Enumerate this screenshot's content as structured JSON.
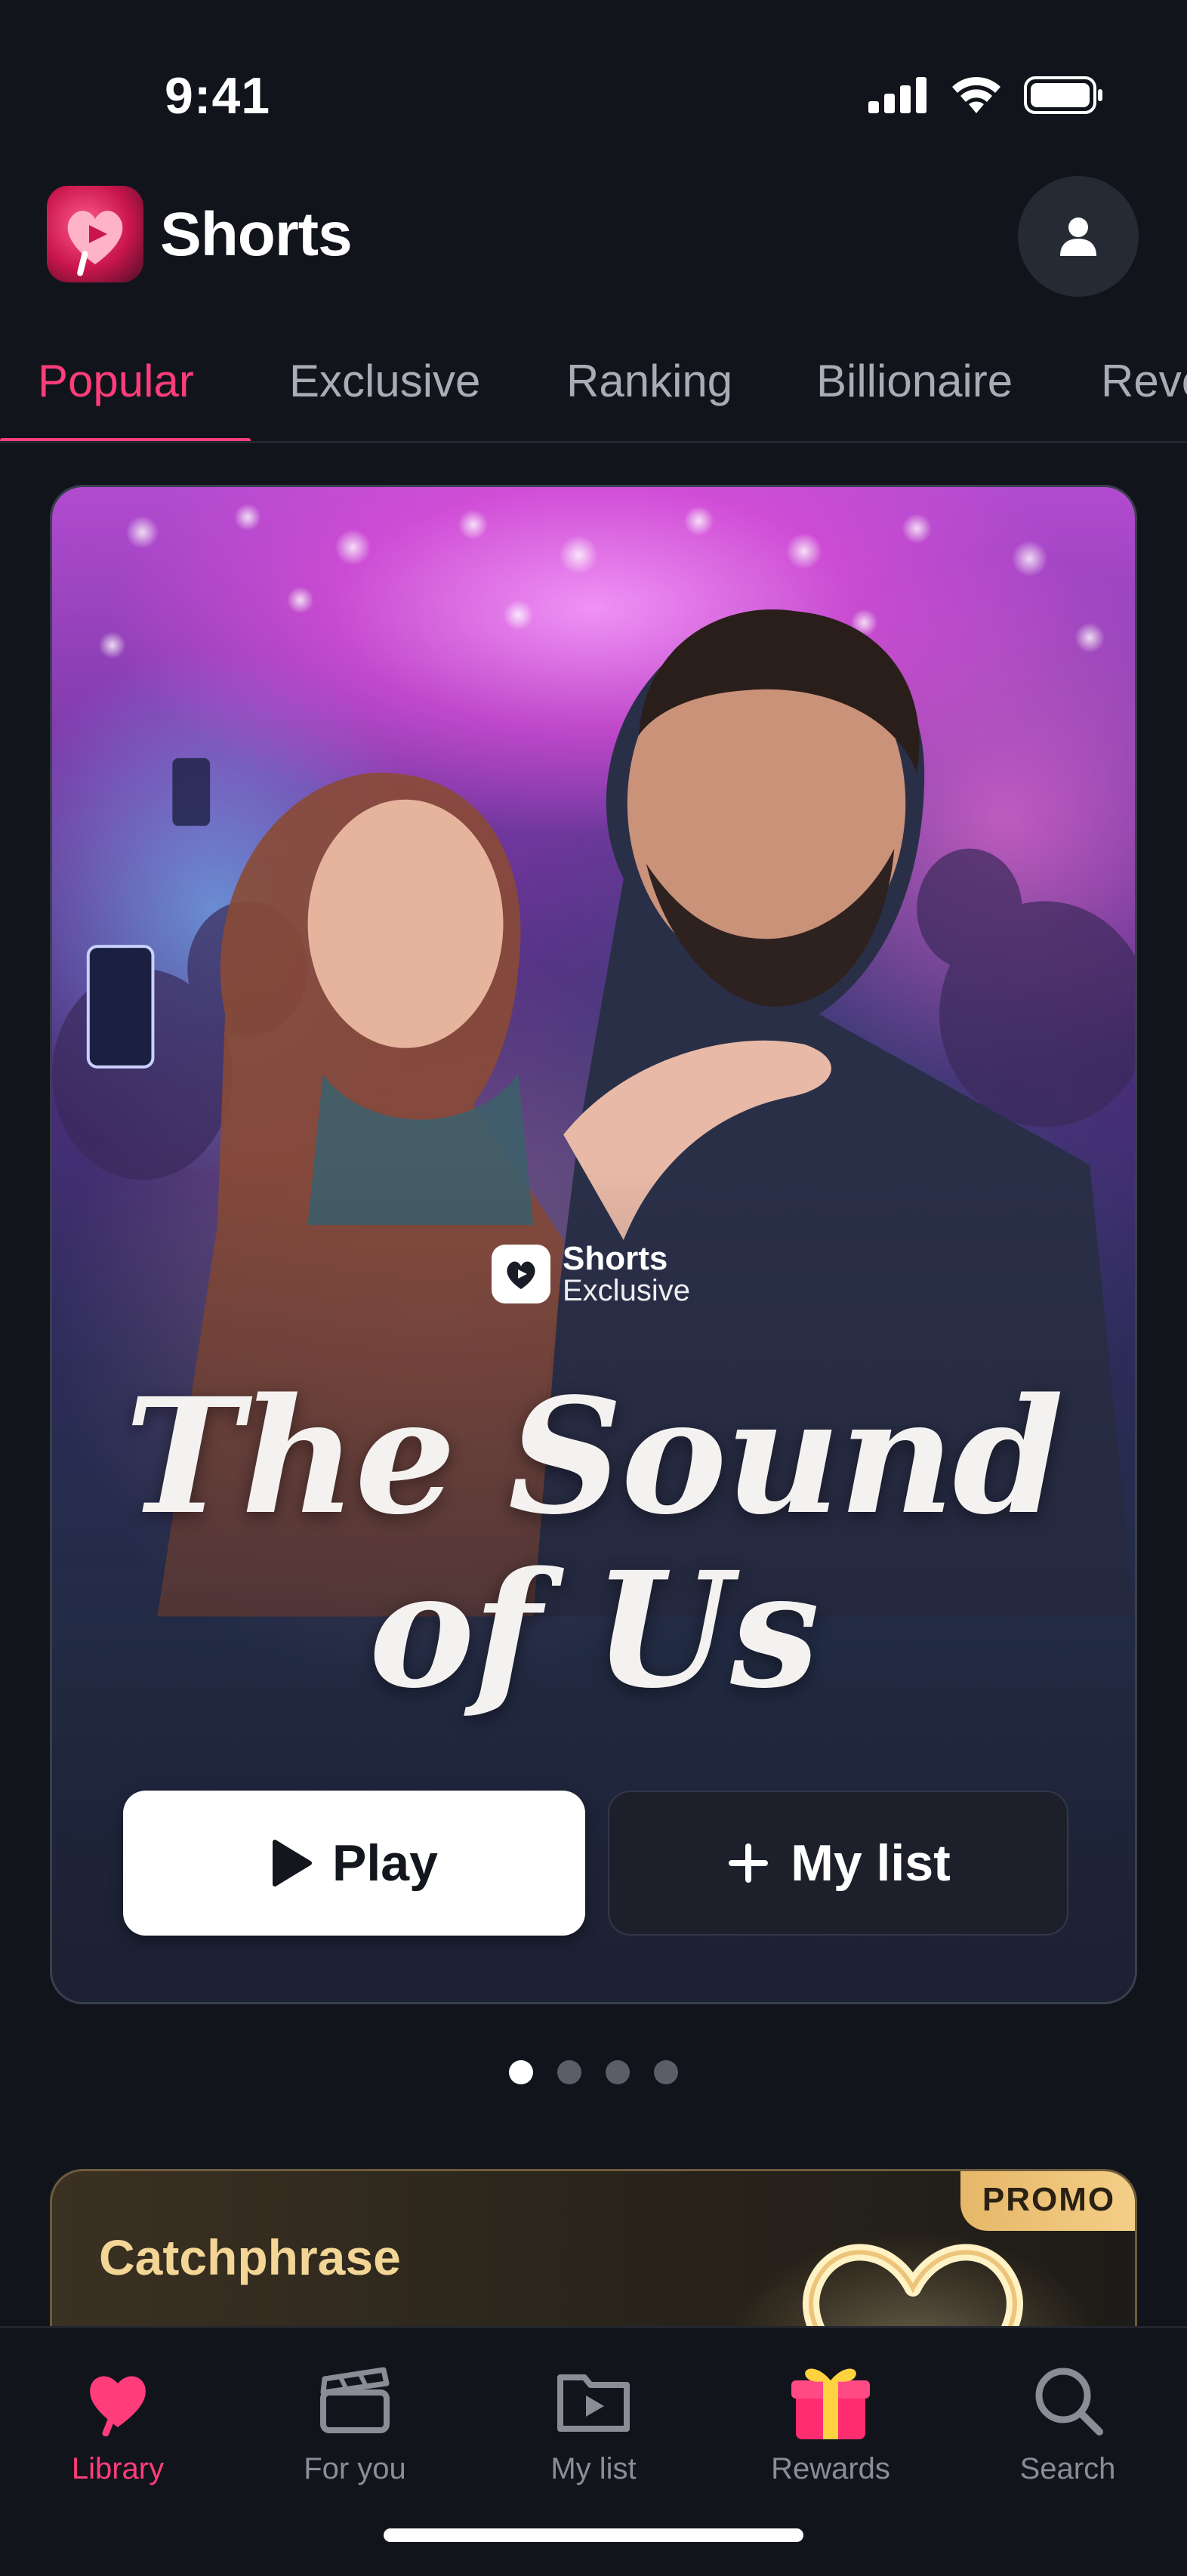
{
  "status_bar": {
    "time": "9:41"
  },
  "header": {
    "app_title": "Shorts"
  },
  "tabs": [
    {
      "label": "Popular",
      "active": true
    },
    {
      "label": "Exclusive"
    },
    {
      "label": "Ranking"
    },
    {
      "label": "Billionaire"
    },
    {
      "label": "Reve"
    }
  ],
  "hero": {
    "badge_line1": "Shorts",
    "badge_line2": "Exclusive",
    "title_line1": "The Sound",
    "title_line2": "of Us",
    "play_label": "Play",
    "mylist_label": "My list"
  },
  "carousel": {
    "pages": 4,
    "active_index": 0
  },
  "promo": {
    "title": "Catchphrase",
    "badge": "PROMO"
  },
  "bottom_nav": [
    {
      "label": "Library",
      "icon": "heart-icon",
      "active": true
    },
    {
      "label": "For you",
      "icon": "clapperboard-icon"
    },
    {
      "label": "My list",
      "icon": "play-folder-icon"
    },
    {
      "label": "Rewards",
      "icon": "gift-icon"
    },
    {
      "label": "Search",
      "icon": "search-icon"
    }
  ],
  "colors": {
    "accent": "#ff3d7a",
    "background": "#12141c",
    "promo_gold": "#f3d596"
  }
}
